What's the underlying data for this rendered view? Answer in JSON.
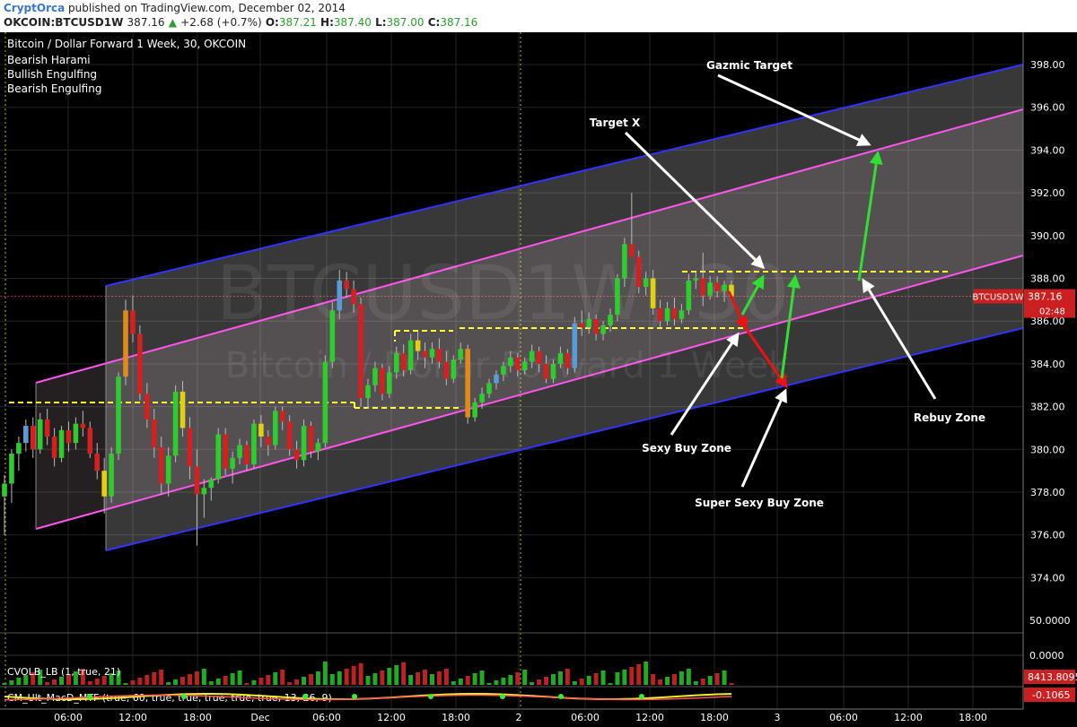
{
  "header": {
    "publisher": "CryptOrca",
    "published_text": "published on TradingView.com, December 02, 2014",
    "symbol": "OKCOIN:BTCUSD1W",
    "last": "387.16",
    "change": "+2.68 (+0.7%)",
    "open_label": "O:",
    "open": "387.21",
    "high_label": "H:",
    "high": "387.40",
    "low_label": "L:",
    "low": "387.00",
    "close_label": "C:",
    "close": "387.16"
  },
  "chart_data": {
    "type": "candlestick",
    "title": "Bitcoin / Dollar Forward 1 Week, 30, OKCOIN",
    "watermark_symbol": "BTCUSD1W, 30",
    "watermark_name": "Bitcoin / Dollar Forward 1 Week",
    "legend": [
      "Bearish Harami",
      "Bullish Engulfing",
      "Bearish Engulfing"
    ],
    "y_ticks": [
      "398.00",
      "396.00",
      "394.00",
      "392.00",
      "390.00",
      "388.00",
      "386.00",
      "384.00",
      "382.00",
      "380.00",
      "378.00",
      "376.00",
      "374.00"
    ],
    "ylim": [
      373,
      399
    ],
    "x_ticks": [
      "06:00",
      "12:00",
      "18:00",
      "Dec",
      "06:00",
      "12:00",
      "18:00",
      "2",
      "06:00",
      "12:00",
      "18:00",
      "3",
      "06:00",
      "12:00",
      "18:00"
    ],
    "price_label": "BTCUSD1W",
    "price_value": "387.16",
    "countdown": "02:48",
    "ohlc": [
      [
        377.8,
        378.8,
        376.0,
        378.4
      ],
      [
        378.4,
        380.0,
        377.5,
        379.8
      ],
      [
        379.8,
        380.6,
        379.0,
        380.3
      ],
      [
        380.3,
        381.4,
        379.9,
        381.1
      ],
      [
        381.1,
        381.5,
        379.6,
        380.0
      ],
      [
        380.0,
        381.7,
        379.8,
        381.4
      ],
      [
        381.4,
        381.9,
        380.2,
        380.6
      ],
      [
        380.6,
        381.0,
        379.2,
        379.6
      ],
      [
        379.6,
        381.1,
        379.4,
        380.9
      ],
      [
        380.9,
        381.3,
        379.9,
        380.3
      ],
      [
        380.3,
        381.5,
        380.0,
        381.2
      ],
      [
        381.2,
        381.8,
        380.6,
        381.0
      ],
      [
        381.0,
        381.3,
        379.6,
        379.8
      ],
      [
        379.8,
        380.3,
        378.6,
        379.0
      ],
      [
        379.0,
        379.6,
        377.0,
        377.8
      ],
      [
        377.8,
        380.1,
        377.5,
        379.8
      ],
      [
        379.8,
        383.6,
        379.5,
        383.4
      ],
      [
        383.4,
        387.0,
        383.0,
        386.5
      ],
      [
        386.5,
        387.2,
        385.0,
        385.4
      ],
      [
        385.4,
        385.8,
        382.3,
        382.6
      ],
      [
        382.6,
        383.1,
        381.0,
        381.4
      ],
      [
        381.4,
        381.9,
        379.6,
        380.1
      ],
      [
        380.1,
        380.6,
        377.9,
        378.4
      ],
      [
        378.4,
        380.1,
        377.8,
        379.7
      ],
      [
        379.7,
        383.0,
        379.4,
        382.7
      ],
      [
        382.7,
        383.2,
        380.6,
        381.0
      ],
      [
        381.0,
        381.5,
        378.6,
        379.2
      ],
      [
        379.2,
        380.0,
        375.5,
        377.9
      ],
      [
        377.9,
        378.6,
        376.8,
        378.2
      ],
      [
        378.2,
        378.7,
        377.6,
        378.6
      ],
      [
        378.6,
        381.0,
        378.4,
        380.7
      ],
      [
        380.7,
        381.0,
        378.8,
        379.1
      ],
      [
        379.1,
        379.9,
        378.4,
        379.6
      ],
      [
        379.6,
        380.5,
        379.3,
        380.2
      ],
      [
        380.2,
        380.4,
        379.0,
        379.3
      ],
      [
        379.3,
        381.4,
        379.1,
        381.2
      ],
      [
        381.2,
        381.6,
        380.1,
        380.6
      ],
      [
        380.6,
        380.9,
        379.7,
        380.2
      ],
      [
        380.2,
        382.0,
        380.0,
        381.8
      ],
      [
        381.8,
        382.0,
        380.9,
        381.3
      ],
      [
        381.3,
        381.6,
        379.7,
        380.0
      ],
      [
        380.0,
        380.4,
        379.1,
        379.5
      ],
      [
        379.5,
        381.4,
        379.2,
        381.1
      ],
      [
        381.1,
        381.3,
        379.6,
        379.9
      ],
      [
        379.9,
        380.5,
        379.5,
        380.3
      ],
      [
        380.3,
        384.4,
        380.1,
        384.1
      ],
      [
        384.1,
        386.9,
        383.8,
        386.5
      ],
      [
        386.5,
        388.4,
        386.1,
        387.9
      ],
      [
        387.9,
        388.3,
        387.1,
        387.5
      ],
      [
        387.5,
        387.9,
        386.4,
        386.8
      ],
      [
        386.8,
        387.1,
        382.0,
        382.4
      ],
      [
        382.4,
        383.3,
        381.9,
        383.0
      ],
      [
        383.0,
        384.1,
        382.7,
        383.8
      ],
      [
        383.8,
        384.0,
        382.3,
        382.6
      ],
      [
        382.6,
        383.9,
        382.4,
        383.6
      ],
      [
        383.6,
        384.8,
        383.3,
        384.5
      ],
      [
        384.5,
        384.9,
        383.4,
        383.7
      ],
      [
        383.7,
        385.4,
        383.5,
        385.1
      ],
      [
        385.1,
        385.5,
        384.2,
        384.6
      ],
      [
        384.6,
        385.0,
        383.8,
        384.3
      ],
      [
        384.3,
        385.0,
        384.0,
        384.7
      ],
      [
        384.7,
        385.2,
        383.8,
        384.1
      ],
      [
        384.1,
        384.6,
        383.0,
        383.3
      ],
      [
        383.3,
        384.4,
        383.1,
        384.2
      ],
      [
        384.2,
        385.0,
        384.0,
        384.7
      ],
      [
        384.7,
        384.9,
        381.2,
        381.5
      ],
      [
        381.5,
        382.4,
        381.3,
        382.2
      ],
      [
        382.2,
        382.9,
        381.9,
        382.6
      ],
      [
        382.6,
        383.3,
        382.4,
        383.1
      ],
      [
        383.1,
        383.7,
        382.8,
        383.5
      ],
      [
        383.5,
        384.1,
        383.2,
        383.9
      ],
      [
        383.9,
        384.6,
        383.6,
        384.3
      ],
      [
        384.3,
        384.5,
        383.4,
        383.7
      ],
      [
        383.7,
        384.3,
        383.5,
        384.1
      ],
      [
        384.1,
        384.9,
        383.8,
        384.6
      ],
      [
        384.6,
        384.8,
        383.6,
        384.0
      ],
      [
        384.0,
        384.4,
        383.1,
        383.3
      ],
      [
        383.3,
        384.2,
        383.1,
        384.0
      ],
      [
        384.0,
        384.8,
        383.8,
        384.5
      ],
      [
        384.5,
        384.7,
        383.5,
        383.8
      ],
      [
        383.8,
        386.2,
        383.6,
        385.9
      ],
      [
        385.9,
        386.5,
        385.3,
        385.7
      ],
      [
        385.7,
        386.4,
        385.4,
        386.1
      ],
      [
        386.1,
        386.3,
        385.1,
        385.4
      ],
      [
        385.4,
        386.0,
        385.1,
        385.8
      ],
      [
        385.8,
        386.6,
        385.5,
        386.3
      ],
      [
        386.3,
        388.2,
        386.0,
        388.0
      ],
      [
        388.0,
        389.9,
        387.6,
        389.6
      ],
      [
        389.6,
        392.0,
        389.1,
        389.0
      ],
      [
        389.0,
        389.3,
        387.3,
        387.6
      ],
      [
        387.6,
        388.3,
        387.2,
        388.0
      ],
      [
        388.0,
        388.4,
        386.3,
        386.6
      ],
      [
        386.6,
        387.0,
        385.7,
        386.0
      ],
      [
        386.0,
        386.9,
        385.8,
        386.6
      ],
      [
        386.6,
        387.1,
        385.8,
        386.1
      ],
      [
        386.1,
        386.8,
        385.9,
        386.5
      ],
      [
        386.5,
        388.2,
        386.3,
        387.9
      ],
      [
        387.9,
        388.3,
        387.5,
        388.0
      ],
      [
        388.0,
        389.2,
        386.7,
        387.2
      ],
      [
        387.2,
        388.1,
        387.0,
        387.8
      ],
      [
        387.8,
        388.1,
        387.1,
        387.4
      ],
      [
        387.4,
        387.9,
        386.9,
        387.7
      ],
      [
        387.7,
        387.9,
        387.0,
        387.16
      ]
    ],
    "candle_colors": {
      "up": "#2ecc2e",
      "down": "#d42020",
      "alt_up": "#5b9bd5",
      "alt_down": "#e0d010",
      "orange": "#e08a1c"
    },
    "channel_outer_color": "#3333ff",
    "channel_inner_color": "#ff55ee",
    "target_line_color": "#ffff33",
    "annotations": [
      "Gazmic Target",
      "Target X",
      "Sexy Buy Zone",
      "Super Sexy Buy Zone",
      "Rebuy Zone"
    ],
    "volume_panel": {
      "label": "CVOLB_LB (1, true, 21)",
      "value": "8413.8095",
      "ticks": [
        "50.0000",
        "0.0000"
      ]
    },
    "macd_panel": {
      "label": "CM_Ult_MacD_MTF (true, 60, true, true, true, true, true, 13, 26, 9)",
      "value": "-0.1065"
    }
  }
}
